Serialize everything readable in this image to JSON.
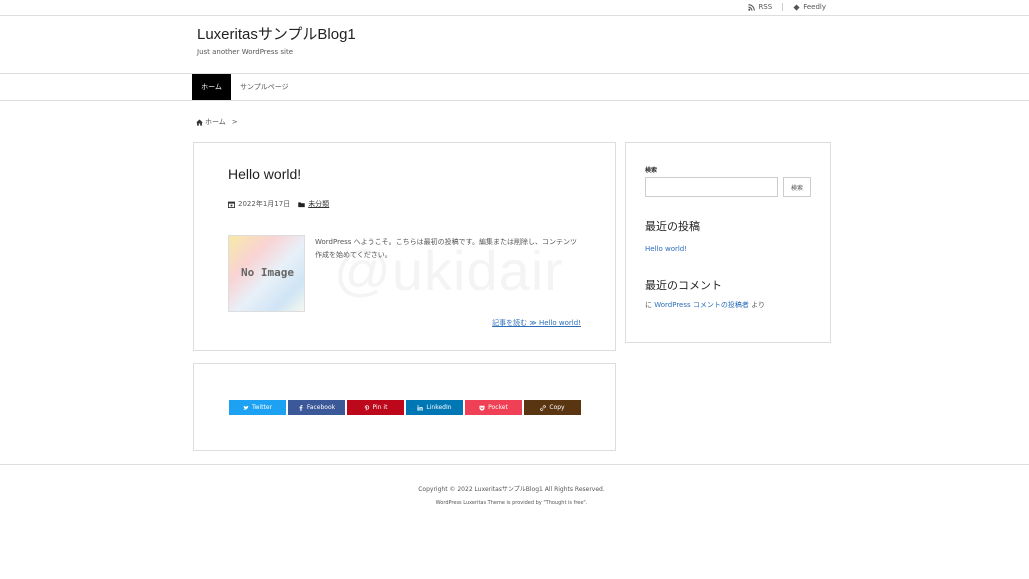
{
  "topbar": {
    "rss_label": "RSS",
    "feedly_label": "Feedly"
  },
  "site": {
    "title": "LuxeritasサンプルBlog1",
    "description": "Just another WordPress site"
  },
  "nav": {
    "items": [
      {
        "label": "ホーム",
        "active": true
      },
      {
        "label": "サンプルページ",
        "active": false
      }
    ]
  },
  "breadcrumb": {
    "home_label": "ホーム",
    "separator": ">"
  },
  "post": {
    "title": "Hello world!",
    "date": "2022年1月17日",
    "category": "未分類",
    "thumbnail_text": "No Image",
    "excerpt": "WordPress へようこそ。こちらは最初の投稿です。編集または削除し、コンテンツ作成を始めてください。",
    "read_more": "記事を読む ≫ Hello world!",
    "watermark": "@ukidair"
  },
  "share": {
    "buttons": [
      {
        "label": "Twitter",
        "color": "#1da1f2",
        "icon": "twitter-icon"
      },
      {
        "label": "Facebook",
        "color": "#3b5998",
        "icon": "facebook-icon"
      },
      {
        "label": "Pin it",
        "color": "#bd081c",
        "icon": "pinterest-icon"
      },
      {
        "label": "LinkedIn",
        "color": "#0077b5",
        "icon": "linkedin-icon"
      },
      {
        "label": "Pocket",
        "color": "#ef4056",
        "icon": "pocket-icon"
      },
      {
        "label": "Copy",
        "color": "#5a3511",
        "icon": "link-icon"
      }
    ]
  },
  "sidebar": {
    "search_label": "検索",
    "search_placeholder": "",
    "search_button": "検索",
    "recent_posts_heading": "最近の投稿",
    "recent_posts": [
      "Hello world!"
    ],
    "recent_comments_heading": "最近のコメント",
    "recent_comment": {
      "author": "WordPress コメントの投稿者",
      "prefix": "に",
      "suffix": "より"
    }
  },
  "footer": {
    "copyright": "Copyright © 2022 LuxeritasサンプルBlog1 All Rights Reserved.",
    "theme_credit": "WordPress Luxeritas Theme is provided by \"Thought is free\"."
  },
  "colors": {
    "link": "#2a6ebb",
    "nav_active_bg": "#000000"
  }
}
